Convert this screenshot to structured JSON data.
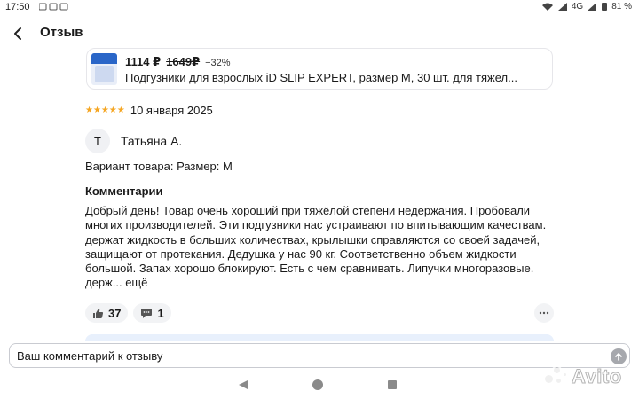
{
  "status_bar": {
    "time": "17:50",
    "network": "4G",
    "battery": "81 %"
  },
  "header": {
    "title": "Отзыв"
  },
  "product": {
    "price_now": "1114 ₽",
    "price_old": "1649₽",
    "discount": "−32%",
    "name": "Подгузники для взрослых iD SLIP EXPERT, размер M, 30 шт. для тяжел..."
  },
  "review": {
    "rating": 5,
    "date": "10 января 2025",
    "author_initial": "Т",
    "author_name": "Татьяна А.",
    "variant": "Вариант товара: Размер: M",
    "comments_heading": "Комментарии",
    "comment_text": "Добрый день! Товар очень хороший при тяжёлой степени недержания. Пробовали многих производителей. Эти подгузники нас устраивают по впитывающим качествам. держат жидкость в больших количествах, крылышки справляются со своей задачей, защищают от протекания. Дедушка у нас 90 кг. Соответственно объем жидкости большой. Запах хорошо блокируют. Есть с чем сравнивать. Липучки многоразовые. держ...",
    "more_label": "ещё"
  },
  "actions": {
    "likes": "37",
    "comments": "1"
  },
  "input": {
    "placeholder": "Ваш комментарий к отзыву"
  },
  "watermark": {
    "brand": "Avito"
  },
  "colors": {
    "star": "#f5a623",
    "reply_strip": "#e8f0fc",
    "send_button": "#a6a8ad"
  }
}
